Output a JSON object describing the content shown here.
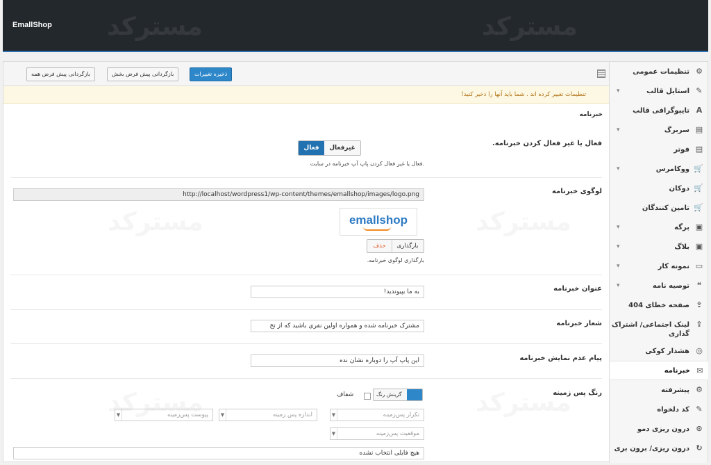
{
  "brand": "EmallShop",
  "watermark": "مسترکد",
  "toolbar": {
    "save": "ذخیره تغییرات",
    "reset_section": "بازگردانی پیش فرض بخش",
    "reset_all": "بازگردانی پیش فرض همه"
  },
  "notice": "تنظیمات تغییر کرده اند . شما باید آنها را ذخیر کنید!",
  "section_title": "خبرنامه",
  "sidebar": [
    {
      "label": "تنظیمات عمومی",
      "icon": "gear-icon",
      "glyph": "⚙",
      "chevron": false
    },
    {
      "label": "استایل قالب",
      "icon": "brush-icon",
      "glyph": "✎",
      "chevron": true
    },
    {
      "label": "تایپوگرافی قالب",
      "icon": "font-icon",
      "glyph": "A",
      "chevron": false
    },
    {
      "label": "سربرگ",
      "icon": "header-icon",
      "glyph": "▤",
      "chevron": true
    },
    {
      "label": "فوتر",
      "icon": "footer-icon",
      "glyph": "▤",
      "chevron": false
    },
    {
      "label": "ووکامرس",
      "icon": "cart-icon",
      "glyph": "🛒",
      "chevron": true
    },
    {
      "label": "دوکان",
      "icon": "cart-icon",
      "glyph": "🛒",
      "chevron": false
    },
    {
      "label": "تامین کنندگان",
      "icon": "cart-icon",
      "glyph": "🛒",
      "chevron": false
    },
    {
      "label": "برگه",
      "icon": "page-icon",
      "glyph": "▣",
      "chevron": true
    },
    {
      "label": "بلاگ",
      "icon": "blog-icon",
      "glyph": "▣",
      "chevron": true
    },
    {
      "label": "نمونه کار",
      "icon": "portfolio-icon",
      "glyph": "▭",
      "chevron": true
    },
    {
      "label": "توصیه نامه",
      "icon": "quote-icon",
      "glyph": "❝",
      "chevron": true
    },
    {
      "label": "صفحه خطای 404",
      "icon": "share-icon",
      "glyph": "⇪",
      "chevron": false
    },
    {
      "label": "لینک اجتماعی/ اشتراک گذاری",
      "icon": "share-icon",
      "glyph": "⇪",
      "chevron": false,
      "two": true
    },
    {
      "label": "هشدار کوکی",
      "icon": "cookie-icon",
      "glyph": "◎",
      "chevron": false
    },
    {
      "label": "خبرنامه",
      "icon": "envelope-icon",
      "glyph": "✉",
      "chevron": false,
      "active": true
    },
    {
      "label": "پیشرفته",
      "icon": "cogs-icon",
      "glyph": "⚙",
      "chevron": false
    },
    {
      "label": "کد دلخواه",
      "icon": "edit-icon",
      "glyph": "✎",
      "chevron": false
    },
    {
      "label": "درون ریزی دمو",
      "icon": "import-icon",
      "glyph": "⊙",
      "chevron": false
    },
    {
      "label": "درون ریزی/ برون بری",
      "icon": "refresh-icon",
      "glyph": "↻",
      "chevron": false,
      "two": true
    }
  ],
  "fields": {
    "toggle": {
      "label": "فعال یا غیر فعال کردن خبرنامه.",
      "on": "فعال",
      "off": "غیرفعال",
      "desc": ".فعال یا غیر فعال کردن پاپ آپ خبرنامه در سایت"
    },
    "logo": {
      "label": "لوگوی خبرنامه",
      "url": "http://localhost/wordpress1/wp-content/themes/emallshop/images/logo.png",
      "logo_text": "emallshop",
      "upload": "بارگذاری",
      "remove": "حذف",
      "desc": "بارگذاری لوگوی خبرنامه."
    },
    "title": {
      "label": "عنوان خبرنامه",
      "value": "به ما بپیوندید!"
    },
    "slogan": {
      "label": "شعار خبرنامه",
      "value": "مشترک خبرنامه شده و همواره اولین نفری باشید که از تخ"
    },
    "dismiss": {
      "label": "پیام عدم نمایش خبرنامه",
      "value": "این پاپ آپ را دوباره نشان نده"
    },
    "bg": {
      "label": "رنگ پس زمینه",
      "color_btn": "گزینش رنگ",
      "color_value": "#2e87c9",
      "transparent": "شفاف",
      "repeat": "تکرار پس‌زمینه",
      "size": "اندازه پس زمینه",
      "attachment": "پیوست پس‌زمینه",
      "position": "موقعیت پس‌زمینه",
      "file": "هیچ فایلی انتخاب نشده"
    }
  }
}
